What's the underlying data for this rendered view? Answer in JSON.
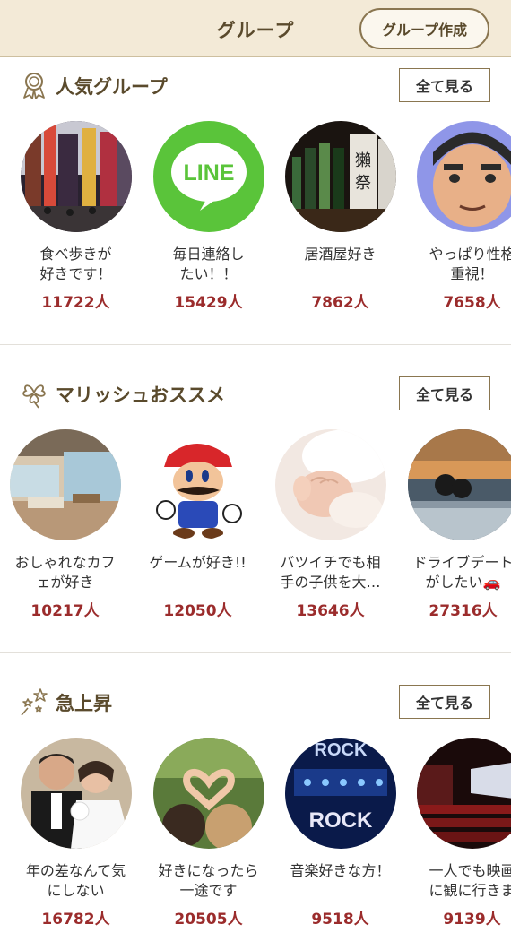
{
  "header": {
    "title": "グループ",
    "create_label": "グループ作成"
  },
  "sections": [
    {
      "title": "人気グループ",
      "see_all": "全て見る",
      "icon": "medal-icon",
      "items": [
        {
          "line1": "食べ歩きが",
          "line2": "好きです！",
          "count": "11722人",
          "image": "city-street-image"
        },
        {
          "line1": "毎日連絡し",
          "line2": "たい！！",
          "count": "15429人",
          "image": "line-logo-image"
        },
        {
          "line1": "居酒屋好き",
          "line2": "",
          "count": "7862人",
          "image": "sake-bottles-image"
        },
        {
          "line1": "やっぱり性格",
          "line2": "重視！",
          "count": "7658人",
          "image": "cartoon-face-image"
        }
      ]
    },
    {
      "title": "マリッシュおススメ",
      "see_all": "全て見る",
      "icon": "clover-icon",
      "items": [
        {
          "line1": "おしゃれなカフ",
          "line2": "ェが好き",
          "count": "10217人",
          "image": "cafe-terrace-image"
        },
        {
          "line1": "ゲームが好き!!",
          "line2": "",
          "count": "12050人",
          "image": "mario-image"
        },
        {
          "line1": "バツイチでも相",
          "line2": "手の子供を大…",
          "count": "13646人",
          "image": "baby-hand-image"
        },
        {
          "line1": "ドライブデート",
          "line2": "がしたい🚗",
          "count": "27316人",
          "image": "couple-car-image"
        }
      ]
    },
    {
      "title": "急上昇",
      "see_all": "全て見る",
      "icon": "sparkle-stars-icon",
      "items": [
        {
          "line1": "年の差なんて気",
          "line2": "にしない",
          "count": "16782人",
          "image": "wedding-couple-image"
        },
        {
          "line1": "好きになったら",
          "line2": "一途です",
          "count": "20505人",
          "image": "heart-hands-image"
        },
        {
          "line1": "音楽好きな方！",
          "line2": "",
          "count": "9518人",
          "image": "rock-stage-image"
        },
        {
          "line1": "一人でも映画",
          "line2": "に観に行きま",
          "count": "9139人",
          "image": "cinema-image"
        }
      ]
    }
  ],
  "colors": {
    "header_bg": "#f3ead7",
    "title_brown": "#5a4a2c",
    "count_red": "#9b2c2c"
  }
}
